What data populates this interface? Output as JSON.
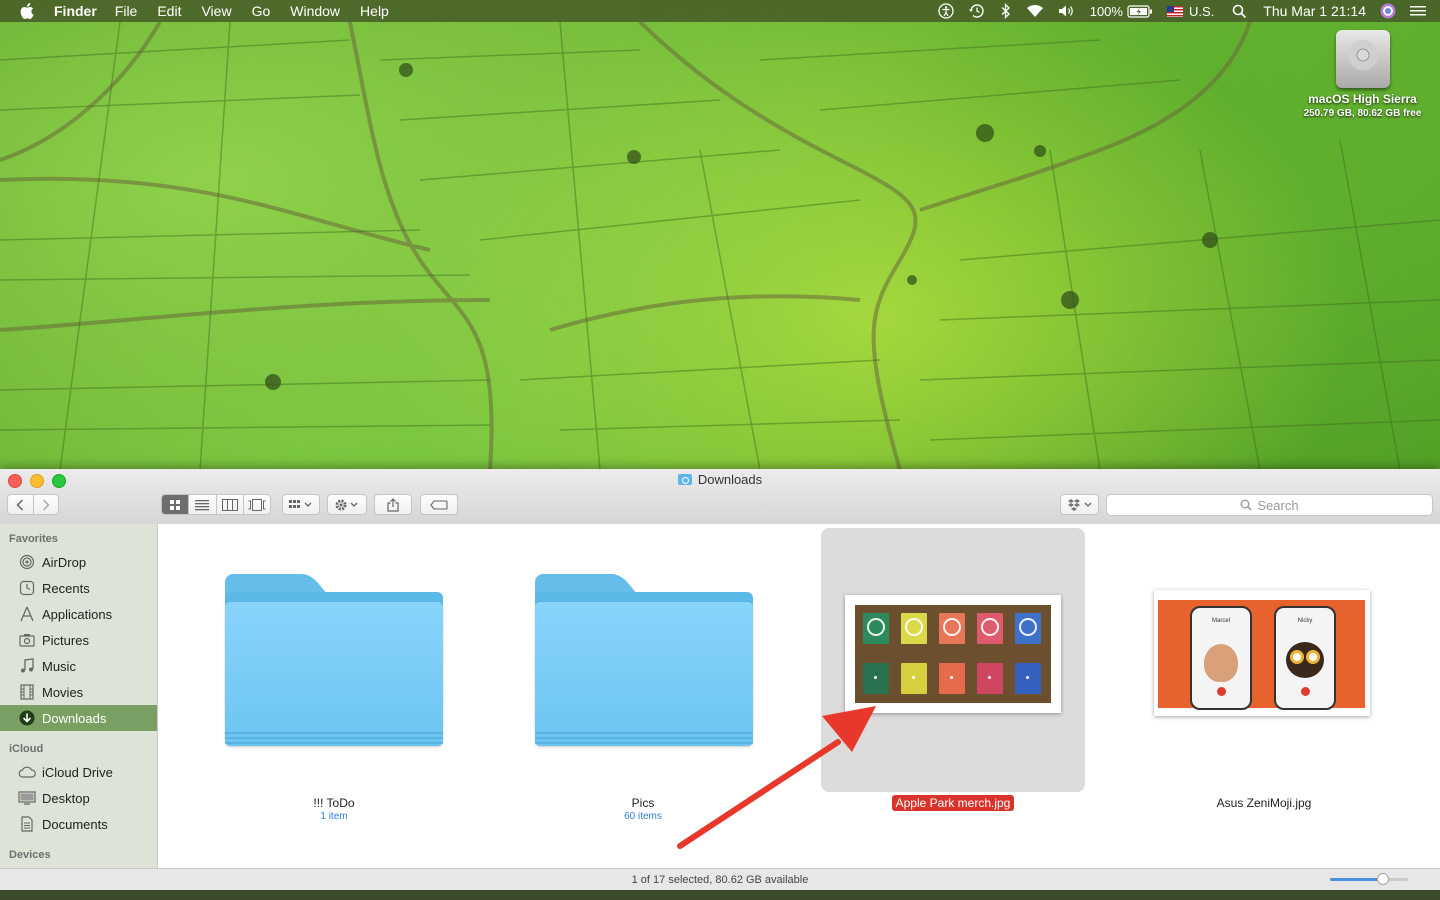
{
  "menubar": {
    "app_name": "Finder",
    "menus": [
      "File",
      "Edit",
      "View",
      "Go",
      "Window",
      "Help"
    ],
    "battery": "100%",
    "input_source": "U.S.",
    "clock": "Thu Mar 1  21:14"
  },
  "desktop": {
    "disk_name": "macOS High Sierra",
    "disk_info": "250.79 GB, 80.62 GB free"
  },
  "window": {
    "title": "Downloads",
    "search_placeholder": "Search"
  },
  "sidebar": {
    "favorites_heading": "Favorites",
    "favorites": [
      {
        "label": "AirDrop",
        "icon": "airdrop-icon"
      },
      {
        "label": "Recents",
        "icon": "clock-icon"
      },
      {
        "label": "Applications",
        "icon": "applications-icon"
      },
      {
        "label": "Pictures",
        "icon": "camera-icon"
      },
      {
        "label": "Music",
        "icon": "music-note-icon"
      },
      {
        "label": "Movies",
        "icon": "film-icon"
      },
      {
        "label": "Downloads",
        "icon": "download-icon",
        "selected": true
      }
    ],
    "icloud_heading": "iCloud",
    "icloud": [
      {
        "label": "iCloud Drive",
        "icon": "cloud-icon"
      },
      {
        "label": "Desktop",
        "icon": "desktop-icon"
      },
      {
        "label": "Documents",
        "icon": "document-icon"
      }
    ],
    "devices_heading": "Devices"
  },
  "files": [
    {
      "name": "!!! ToDo",
      "sub": "1 item",
      "kind": "folder"
    },
    {
      "name": "Pics",
      "sub": "60 items",
      "kind": "folder"
    },
    {
      "name": "Apple Park merch.jpg",
      "kind": "image",
      "selected": true
    },
    {
      "name": "Asus ZeniMoji.jpg",
      "kind": "image"
    }
  ],
  "zenimoji": {
    "left_caller": "Marcel",
    "right_caller": "Nicky"
  },
  "statusbar": {
    "text": "1 of 17 selected, 80.62 GB available",
    "icon_size_fraction": 0.68
  },
  "colors": {
    "selection": "#79a062",
    "selected_label": "#d9342b",
    "annotation_arrow": "#e8382b",
    "folder_blue": "#6cc4f2"
  }
}
